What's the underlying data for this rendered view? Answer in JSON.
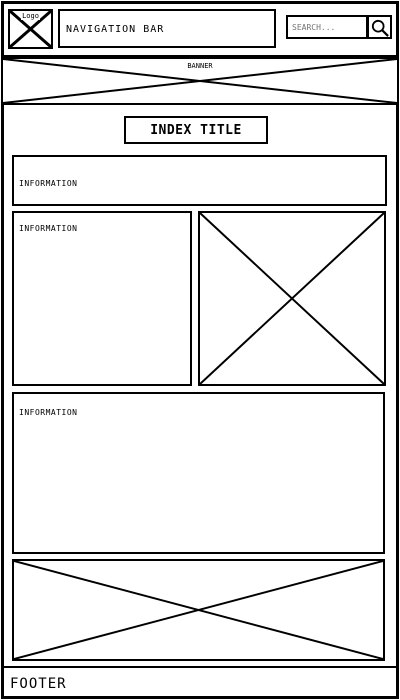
{
  "header": {
    "logo_label": "Logo",
    "nav_label": "NAVIGATION BAR",
    "search": {
      "placeholder": "SEARCH..."
    },
    "search_icon": "magnifier-icon"
  },
  "banner": {
    "label": "BANNER"
  },
  "main": {
    "title": "INDEX TITLE",
    "blocks": [
      {
        "label": "INFORMATION"
      },
      {
        "label": "INFORMATION"
      },
      {
        "label": "INFORMATION"
      }
    ]
  },
  "footer": {
    "label": "FOOTER"
  }
}
